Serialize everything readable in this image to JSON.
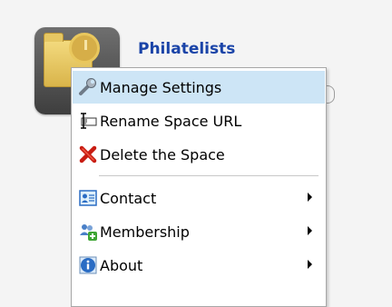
{
  "space": {
    "title": "Philatelists",
    "icon": "folder-clock-icon"
  },
  "menu": {
    "items": [
      {
        "label": "Manage Settings",
        "icon": "wrench-icon",
        "highlighted": true
      },
      {
        "label": "Rename Space URL",
        "icon": "text-cursor-icon"
      },
      {
        "label": "Delete the Space",
        "icon": "red-x-icon"
      },
      {
        "label": "Contact",
        "icon": "contact-card-icon",
        "submenu": true
      },
      {
        "label": "Membership",
        "icon": "add-members-icon",
        "submenu": true
      },
      {
        "label": "About",
        "icon": "info-icon",
        "submenu": true
      }
    ]
  }
}
